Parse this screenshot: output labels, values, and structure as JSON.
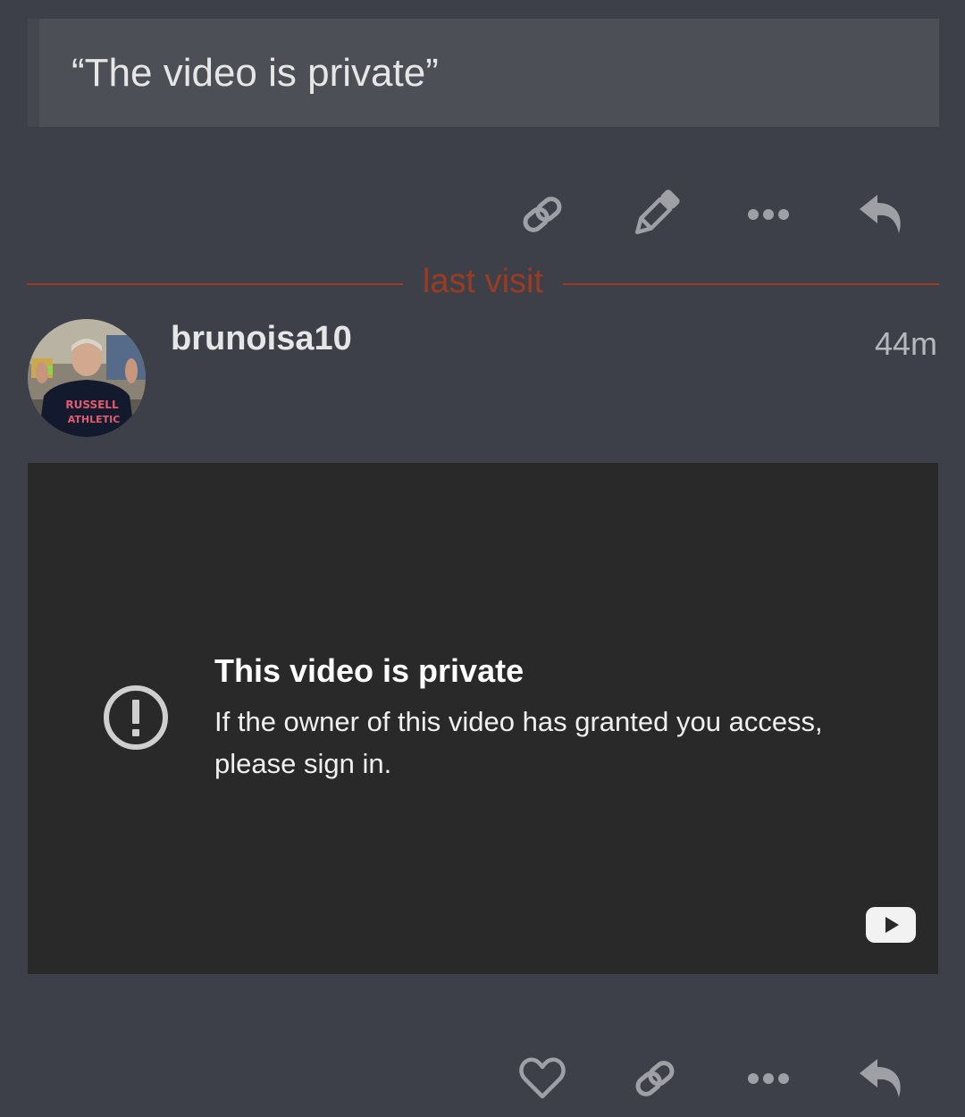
{
  "quote": {
    "text": "“The video is private”"
  },
  "actions_top": {
    "items": [
      {
        "icon": "link-icon",
        "label": "Copy link"
      },
      {
        "icon": "pencil-icon",
        "label": "Edit"
      },
      {
        "icon": "more-icon",
        "label": "More"
      },
      {
        "icon": "reply-icon",
        "label": "Reply"
      }
    ]
  },
  "divider": {
    "label": "last visit",
    "color": "#9a3c23"
  },
  "post": {
    "username": "brunoisa10",
    "time_ago": "44m",
    "avatar_shirt_text": [
      "RUSSELL",
      "ATHLETIC"
    ]
  },
  "video": {
    "title": "This video is private",
    "message": "If the owner of this video has granted you access, please sign in.",
    "alert_icon": "alert-circle-icon",
    "logo_icon": "youtube-logo-icon"
  },
  "actions_bottom": {
    "items": [
      {
        "icon": "heart-icon",
        "label": "Like"
      },
      {
        "icon": "link-icon",
        "label": "Copy link"
      },
      {
        "icon": "more-icon",
        "label": "More"
      },
      {
        "icon": "reply-icon",
        "label": "Reply"
      }
    ]
  },
  "colors": {
    "background": "#3d4048",
    "quote_background": "#4c4f55",
    "icon": "#9ea0a5",
    "video_background": "#292929"
  }
}
